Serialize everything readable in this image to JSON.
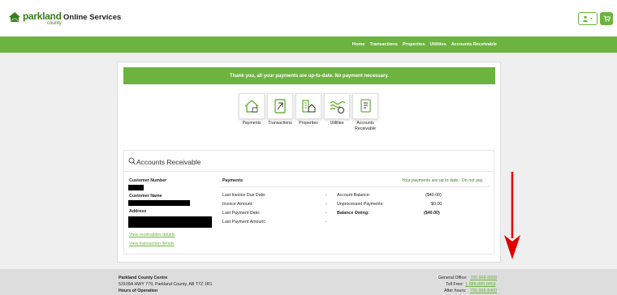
{
  "header": {
    "logo_name": "parkland",
    "logo_sub": "county",
    "site_title": "Online Services"
  },
  "nav": [
    "Home",
    "Transactions",
    "Properties",
    "Utilities",
    "Accounts Receivable"
  ],
  "banner": "Thank you, all your payments are up-to-date. No payment necessary.",
  "tiles": [
    {
      "label": "Payments",
      "icon": "house-payment-icon"
    },
    {
      "label": "Transactions",
      "icon": "transactions-icon"
    },
    {
      "label": "Properties",
      "icon": "properties-icon"
    },
    {
      "label": "Utilities",
      "icon": "utilities-icon"
    },
    {
      "label": "Accounts Receivable",
      "icon": "accounts-receivable-icon"
    }
  ],
  "accounts": {
    "title": "Accounts Receivable",
    "customer_number_label": "Customer Number",
    "customer_name_label": "Customer Name",
    "address_label": "Address",
    "link_receivables": "View receivables details",
    "link_transactions": "View transaction details",
    "payments_heading": "Payments",
    "status": "Your payments are up to date - Do not pay",
    "left_rows": [
      {
        "label": "Last Invoice Due Date:",
        "value": "-"
      },
      {
        "label": "Invoice Amount:",
        "value": "-"
      },
      {
        "label": "Last Payment Date:",
        "value": "-"
      },
      {
        "label": "Last Payment Amount:",
        "value": "-"
      }
    ],
    "right_rows": [
      {
        "label": "Account Balance:",
        "value": "($40.00)"
      },
      {
        "label": "Unprocessed Payments:",
        "value": "$0.00"
      },
      {
        "label": "Balance Owing:",
        "value": "($40.00)"
      }
    ]
  },
  "footer": {
    "org": "Parkland County Centre",
    "address": "53109A HWY 779, Parkland County, AB T7Z 1R1",
    "hours": "Hours of Operation",
    "general_label": "General Office:",
    "general_phone": "780-968-8888",
    "tollfree_label": "Toll Free:",
    "tollfree_phone": "1-888-880-0858",
    "afterhours_label": "After hours:",
    "afterhours_phone": "780-968-8400"
  },
  "colors": {
    "brand_green": "#6cb33f",
    "arrow_red": "#e00000"
  }
}
